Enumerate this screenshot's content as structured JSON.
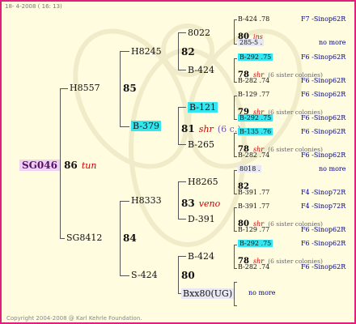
{
  "header": {
    "date": "18- 4-2008 ( 16: 13)"
  },
  "footer": {
    "copyright": "Copyright 2004-2008 @ Karl Kehrle Foundation."
  },
  "root": {
    "id": "SG046",
    "number": "86",
    "tag": "tun"
  },
  "gen1": {
    "top": {
      "id": "H8557",
      "number": "85"
    },
    "bottom": {
      "id": "SG8412",
      "number": "84"
    }
  },
  "gen2": {
    "a": {
      "id": "H8245",
      "number": "82"
    },
    "b": {
      "id": "B-379",
      "number": "81",
      "tag": "shr",
      "note": "(6 c.)"
    },
    "c": {
      "id": "H8333",
      "number": "83",
      "tag": "veno"
    },
    "d": {
      "id": "S-424",
      "number": "80"
    }
  },
  "gen3": {
    "a1": "8022",
    "a2": "B-424",
    "b1": "B-121",
    "b2": "B-265",
    "c1": "H8265",
    "c2": "D-391",
    "d1": "B-424",
    "d2": "Bxx80(UG)"
  },
  "gen4": {
    "r01": {
      "id": "B-424",
      "val": ".78",
      "loc": "F7 -Sinop62R"
    },
    "r02": {
      "num": "80",
      "tag": "ins"
    },
    "r03": {
      "id": "285-5",
      "val": ".",
      "loc": "no more"
    },
    "r04": {
      "id": "B-292",
      "val": ".75",
      "loc": "F6 -Sinop62R"
    },
    "r05": {
      "num": "78",
      "tag": "shr",
      "note": "(6 sister colonies)"
    },
    "r06": {
      "id": "B-282",
      "val": ".74",
      "loc": "F6 -Sinop62R"
    },
    "r07": {
      "id": "B-129",
      "val": ".77",
      "loc": "F6 -Sinop62R"
    },
    "r08": {
      "num": "79",
      "tag": "shr",
      "note": "(6 sister colonies)"
    },
    "r09": {
      "id": "B-292",
      "val": ".75",
      "loc": "F6 -Sinop62R"
    },
    "r10": {
      "id": "B-135",
      "val": ".76",
      "loc": "F6 -Sinop62R"
    },
    "r11": {
      "num": "78",
      "tag": "shr",
      "note": "(6 sister colonies)"
    },
    "r12": {
      "id": "B-282",
      "val": ".74",
      "loc": "F6 -Sinop62R"
    },
    "r13": {
      "id": "8018",
      "val": ".",
      "loc": "no more"
    },
    "r14": {
      "num": "82"
    },
    "r15": {
      "id": "B-391",
      "val": ".77",
      "loc": "F4 -Sinop72R"
    },
    "r16": {
      "id": "B-391",
      "val": ".77",
      "loc": "F4 -Sinop72R"
    },
    "r17": {
      "num": "80",
      "tag": "shr",
      "note": "(6 sister colonies)"
    },
    "r18": {
      "id": "B-129",
      "val": ".77",
      "loc": "F6 -Sinop62R"
    },
    "r19": {
      "id": "B-292",
      "val": ".75",
      "loc": "F6 -Sinop62R"
    },
    "r20": {
      "num": "78",
      "tag": "shr",
      "note": "(6 sister colonies)"
    },
    "r21": {
      "id": "B-282",
      "val": ".74",
      "loc": "F6 -Sinop62R"
    },
    "r22": {
      "loc": "no more"
    }
  },
  "colors": {
    "frame": "#e0207a",
    "background": "#fffce0",
    "highlight": "#33e6f0",
    "root_highlight": "#f0d0f4",
    "tag": "#cc0000",
    "link": "#000088"
  }
}
